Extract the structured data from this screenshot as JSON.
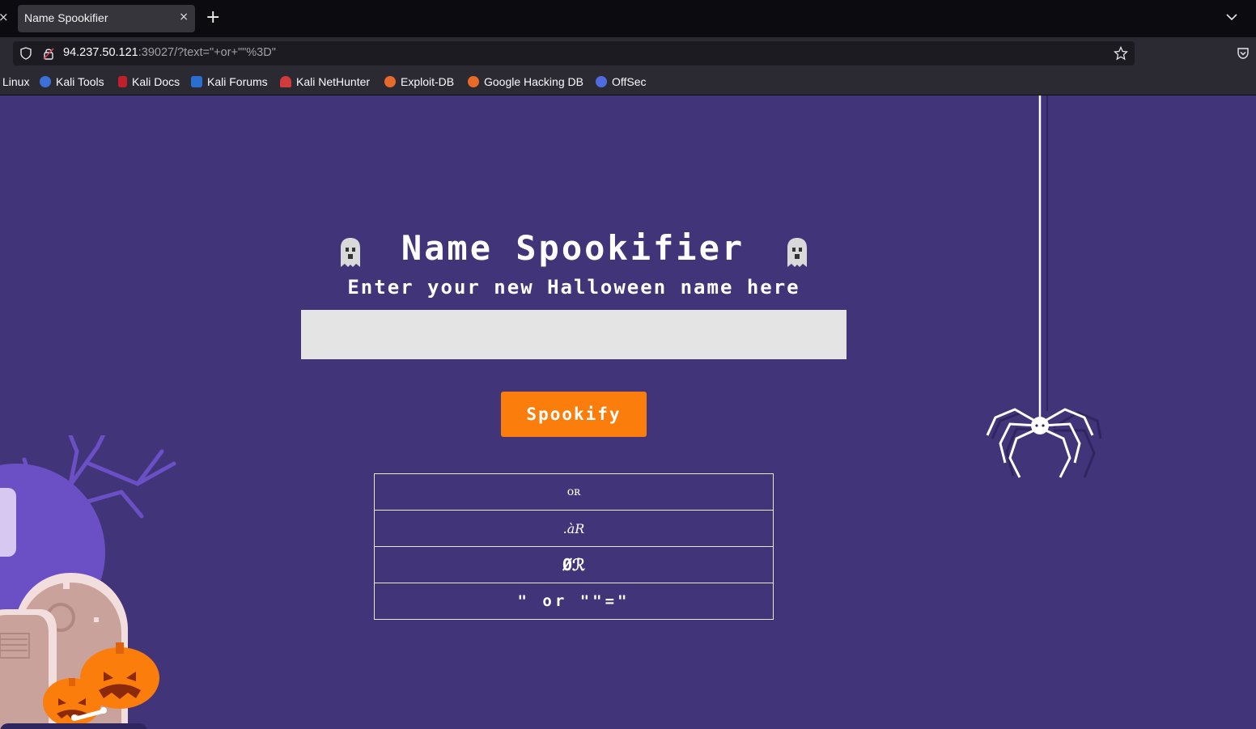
{
  "browser": {
    "left_close_glyph": "×",
    "tab": {
      "title": "Name Spookifier",
      "close_glyph": "×"
    },
    "new_tab_glyph": "+",
    "url": {
      "host": "94.237.50.121",
      "rest": ":39027/?text=\"+or+\"\"%3D\""
    },
    "bookmarks": [
      {
        "label": "Linux",
        "icon": "none",
        "color": ""
      },
      {
        "label": "Kali Tools",
        "icon": "kali-tools-icon",
        "color": "#3d6fd8"
      },
      {
        "label": "Kali Docs",
        "icon": "kali-docs-icon",
        "color": "#c0202a"
      },
      {
        "label": "Kali Forums",
        "icon": "kali-forums-icon",
        "color": "#2a6fd0"
      },
      {
        "label": "Kali NetHunter",
        "icon": "nethunter-icon",
        "color": "#d23b3b"
      },
      {
        "label": "Exploit-DB",
        "icon": "exploit-db-icon",
        "color": "#e86a2b"
      },
      {
        "label": "Google Hacking DB",
        "icon": "ghdb-icon",
        "color": "#e86a2b"
      },
      {
        "label": "OffSec",
        "icon": "offsec-icon",
        "color": "#4f6be0"
      }
    ]
  },
  "page": {
    "title": "Name Spookifier",
    "subtitle": "Enter your new Halloween name here",
    "input": {
      "value": "",
      "placeholder": ""
    },
    "button_label": "Spookify",
    "results": [
      "ᴏʀ",
      ".àR",
      "Øℛ",
      "\" or \"\"=\""
    ]
  },
  "colors": {
    "background": "#423478",
    "button": "#fb7d0b",
    "input": "#e4e4e4"
  }
}
